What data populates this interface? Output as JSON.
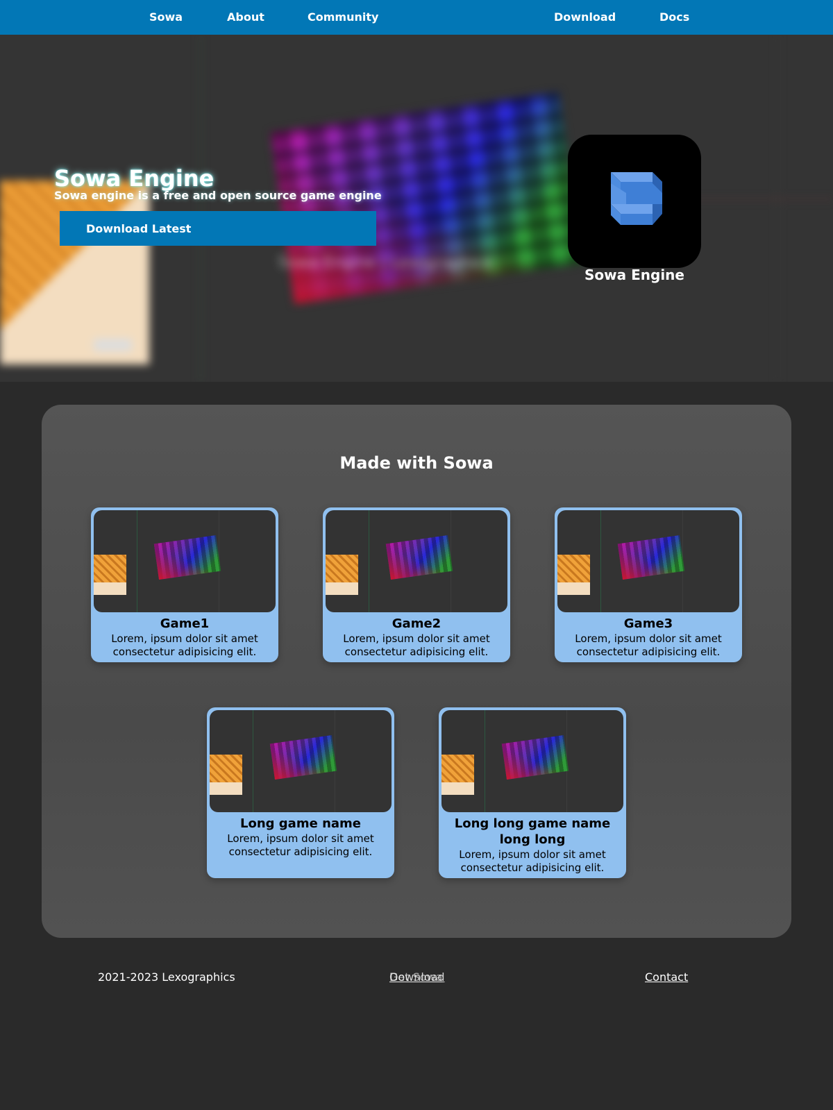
{
  "nav": {
    "items": [
      {
        "label": "Sowa"
      },
      {
        "label": "About"
      },
      {
        "label": "Community"
      },
      {
        "label": "Download"
      },
      {
        "label": "Docs"
      }
    ]
  },
  "hero": {
    "title": "Sowa Engine",
    "subtitle": "Sowa engine is a free and open source game engine",
    "download_button": "Download Latest",
    "background_caption": "Sowa Engine | Lexographics",
    "logo_label": "Sowa Engine"
  },
  "games": {
    "heading": "Made with Sowa",
    "items": [
      {
        "name": "Game1",
        "description": "Lorem, ipsum dolor sit amet consectetur adipisicing elit."
      },
      {
        "name": "Game2",
        "description": "Lorem, ipsum dolor sit amet consectetur adipisicing elit."
      },
      {
        "name": "Game3",
        "description": "Lorem, ipsum dolor sit amet consectetur adipisicing elit."
      },
      {
        "name": "Long game name",
        "description": "Lorem, ipsum dolor sit amet consectetur adipisicing elit."
      },
      {
        "name": "Long long game name long long",
        "description": "Lorem, ipsum dolor sit amet consectetur adipisicing elit."
      }
    ]
  },
  "footer": {
    "copyright": "2021-2023 Lexographics",
    "middle_overlap_a": "Get Sowa",
    "middle_overlap_b": "Download",
    "contact": "Contact"
  },
  "colors": {
    "nav_bg": "#0277b6",
    "card_bg": "#90c0ef",
    "logo_blue": "#3f7fd6"
  }
}
